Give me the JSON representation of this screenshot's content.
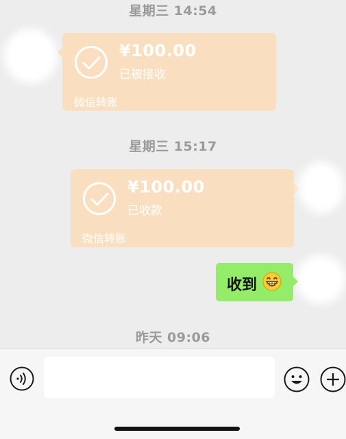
{
  "messages": [
    {
      "timestamp": "星期三 14:54",
      "amount": "¥100.00",
      "status": "已被接收",
      "brand": "微信转账"
    },
    {
      "timestamp": "星期三 15:17",
      "amount": "¥100.00",
      "status": "已收款",
      "brand": "微信转账"
    }
  ],
  "reply": {
    "text": "收到",
    "emoji": "grinning-face-emoji"
  },
  "divider": {
    "timestamp": "昨天 09:06"
  },
  "input_bar": {
    "voice_icon": "voice-icon",
    "emoji_icon": "smiley-icon",
    "plus_icon": "plus-icon",
    "message_value": ""
  },
  "colors": {
    "background": "#ededed",
    "transfer_card": "#f9dfc0",
    "sent_bubble": "#95ec69",
    "timestamp_text": "#9a9a9a"
  }
}
